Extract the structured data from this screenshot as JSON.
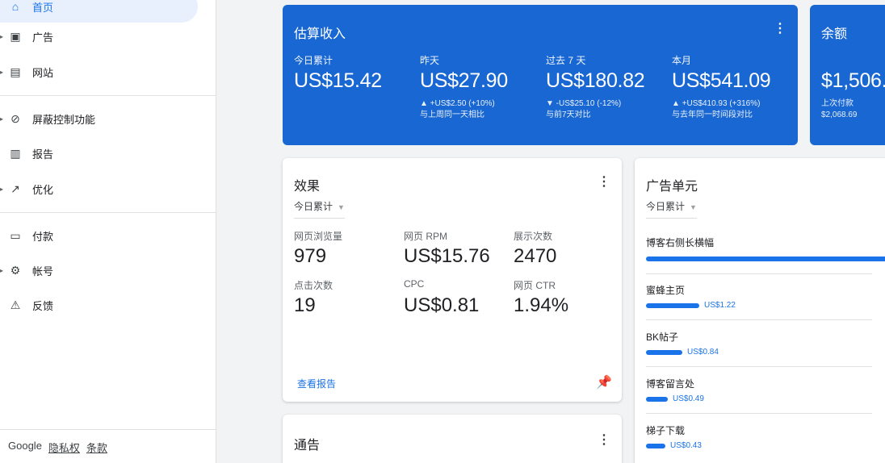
{
  "sidebar": {
    "items": [
      {
        "label": "首页",
        "icon": "home-icon"
      },
      {
        "label": "广告",
        "icon": "ads-icon"
      },
      {
        "label": "网站",
        "icon": "sites-icon"
      },
      {
        "label": "屏蔽控制功能",
        "icon": "block-icon"
      },
      {
        "label": "报告",
        "icon": "reports-icon"
      },
      {
        "label": "优化",
        "icon": "optimization-icon"
      },
      {
        "label": "付款",
        "icon": "payments-icon"
      },
      {
        "label": "帐号",
        "icon": "settings-icon"
      },
      {
        "label": "反馈",
        "icon": "feedback-icon"
      }
    ],
    "footer": {
      "brand": "Google",
      "privacy": "隐私权",
      "terms": "条款"
    }
  },
  "earnings": {
    "title": "估算收入",
    "kpis": [
      {
        "label": "今日累计",
        "value": "US$15.42",
        "change": "",
        "compare": ""
      },
      {
        "label": "昨天",
        "value": "US$27.90",
        "change": "▲ +US$2.50 (+10%)",
        "compare": "与上周同一天相比"
      },
      {
        "label": "过去 7 天",
        "value": "US$180.82",
        "change": "▼ -US$25.10 (-12%)",
        "compare": "与前7天对比"
      },
      {
        "label": "本月",
        "value": "US$541.09",
        "change": "▲ +US$410.93 (+316%)",
        "compare": "与去年同一时间段对比"
      }
    ]
  },
  "balance": {
    "title": "余额",
    "value": "$1,506.",
    "last_payment_label": "上次付款",
    "last_payment_value": "$2,068.69"
  },
  "performance": {
    "title": "效果",
    "range": "今日累计",
    "metrics": [
      {
        "label": "网页浏览量",
        "value": "979"
      },
      {
        "label": "网页 RPM",
        "value": "US$15.76"
      },
      {
        "label": "展示次数",
        "value": "2470"
      },
      {
        "label": "点击次数",
        "value": "19"
      },
      {
        "label": "CPC",
        "value": "US$0.81"
      },
      {
        "label": "网页 CTR",
        "value": "1.94%"
      }
    ],
    "report_link": "查看报告"
  },
  "ad_units": {
    "title": "广告单元",
    "range": "今日累计",
    "units": [
      {
        "name": "博客右侧长横幅",
        "value": "",
        "share": 1.0
      },
      {
        "name": "蜜蜂主页",
        "value": "US$1.22",
        "share": 0.22
      },
      {
        "name": "BK帖子",
        "value": "US$0.84",
        "share": 0.15
      },
      {
        "name": "博客留言处",
        "value": "US$0.49",
        "share": 0.09
      },
      {
        "name": "梯子下载",
        "value": "US$0.43",
        "share": 0.08
      }
    ]
  },
  "notices": {
    "title": "通告"
  },
  "colors": {
    "brand_blue": "#1967d2",
    "link_blue": "#1a73e8"
  }
}
